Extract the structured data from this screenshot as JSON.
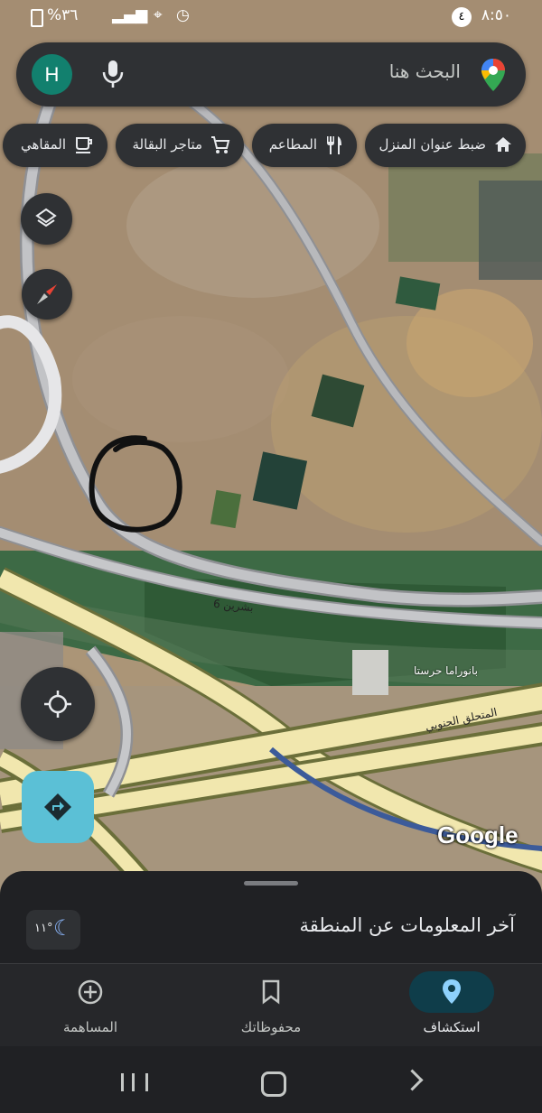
{
  "status_bar": {
    "time": "٨:٥٠",
    "notification_count": "٤",
    "battery": "%٣٦"
  },
  "search": {
    "placeholder": "البحث هنا",
    "avatar_letter": "H"
  },
  "chips": [
    {
      "label": "ضبط عنوان المنزل",
      "icon": "home-icon"
    },
    {
      "label": "المطاعم",
      "icon": "restaurant-icon"
    },
    {
      "label": "متاجر البقالة",
      "icon": "shopping-cart-icon"
    },
    {
      "label": "المقاهي",
      "icon": "coffee-icon"
    }
  ],
  "map": {
    "road_label_1": "6 بشرين",
    "place_label": "بانوراما حرستا",
    "road_label_2": "المتحلق الجنوبي",
    "watermark": "Google"
  },
  "sheet": {
    "title": "آخر المعلومات عن المنطقة",
    "weather_temp": "١١°"
  },
  "bottom_nav": [
    {
      "label": "استكشاف",
      "icon": "explore-pin-icon",
      "active": true
    },
    {
      "label": "محفوظاتك",
      "icon": "bookmark-icon",
      "active": false
    },
    {
      "label": "المساهمة",
      "icon": "add-circle-icon",
      "active": false
    }
  ],
  "colors": {
    "accent_teal": "#5bc0d6",
    "avatar_green": "#12806e",
    "surface_dark": "#2f3134"
  }
}
